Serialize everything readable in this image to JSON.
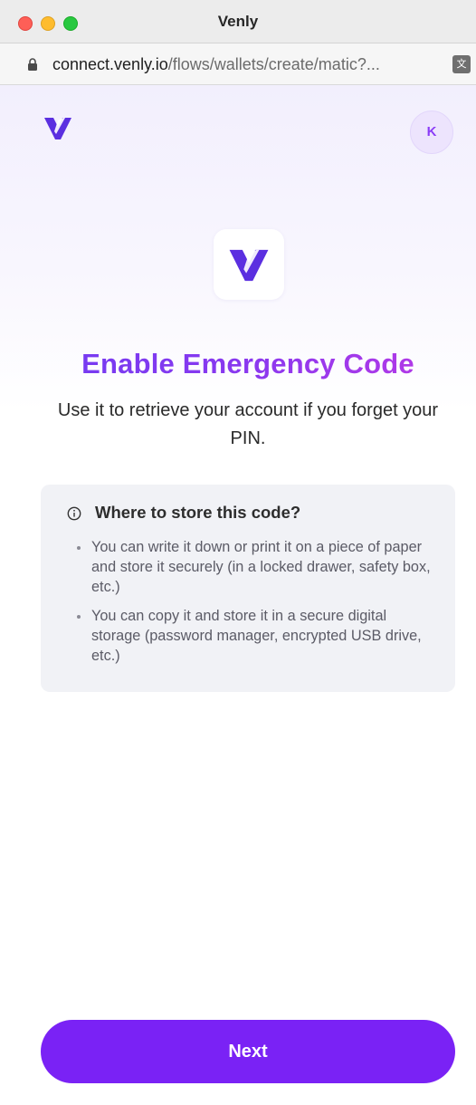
{
  "window": {
    "title": "Venly"
  },
  "address_bar": {
    "domain": "connect.venly.io",
    "path": "/flows/wallets/create/matic?..."
  },
  "header": {
    "avatar_initial": "K"
  },
  "main": {
    "title": "Enable Emergency Code",
    "subtitle": "Use it to retrieve your account if you forget your PIN."
  },
  "info_box": {
    "heading": "Where to store this code?",
    "items": [
      "You can write it down or print it on a piece of paper and store it securely (in a locked drawer, safety box, etc.)",
      "You can copy it and store it in a secure digital storage (password manager, encrypted USB drive, etc.)"
    ]
  },
  "actions": {
    "next_label": "Next"
  },
  "colors": {
    "brand_purple": "#7a22f5",
    "title_gradient_start": "#6f3cf2",
    "title_gradient_end": "#c23ae4",
    "info_box_bg": "#f1f2f6"
  },
  "icons": {
    "lock": "lock-icon",
    "translate": "translate-icon",
    "logo": "venly-logo-icon",
    "info": "info-icon"
  }
}
